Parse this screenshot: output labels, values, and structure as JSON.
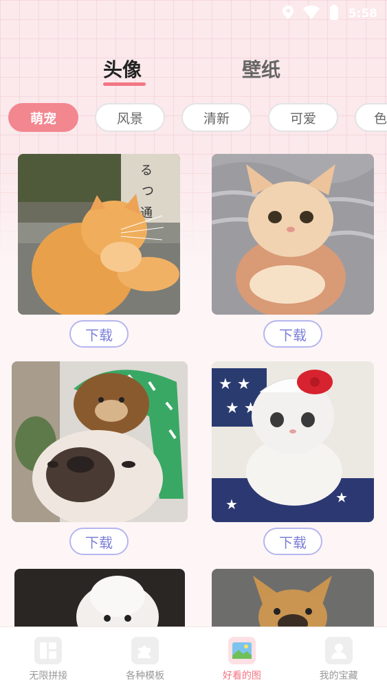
{
  "status_bar": {
    "time": "5:58",
    "icons": [
      "location-icon",
      "wifi-icon",
      "battery-icon"
    ]
  },
  "main_tabs": [
    {
      "label": "头像",
      "active": true
    },
    {
      "label": "壁纸",
      "active": false
    }
  ],
  "categories": [
    {
      "label": "萌宠",
      "active": true
    },
    {
      "label": "风景",
      "active": false
    },
    {
      "label": "清新",
      "active": false
    },
    {
      "label": "可爱",
      "active": false
    },
    {
      "label": "色",
      "active": false
    }
  ],
  "cards": [
    {
      "subject": "orange-cat",
      "download_label": "下载"
    },
    {
      "subject": "cream-cat-in-hands",
      "download_label": "下载"
    },
    {
      "subject": "bulldog-with-bear-hat",
      "download_label": "下载"
    },
    {
      "subject": "cat-with-hello-kitty-hat",
      "download_label": "下载"
    },
    {
      "subject": "white-dog"
    },
    {
      "subject": "french-bulldog"
    }
  ],
  "bottom_nav": [
    {
      "label": "无限拼接",
      "icon": "grid-icon",
      "active": false
    },
    {
      "label": "各种模板",
      "icon": "puzzle-icon",
      "active": false
    },
    {
      "label": "好看的图",
      "icon": "image-icon",
      "active": true
    },
    {
      "label": "我的宝藏",
      "icon": "user-icon",
      "active": false
    }
  ],
  "colors": {
    "accent": "#f27583",
    "chip_active": "#f28790",
    "download_border": "#b5b6ee",
    "download_text": "#7d7fd8"
  }
}
